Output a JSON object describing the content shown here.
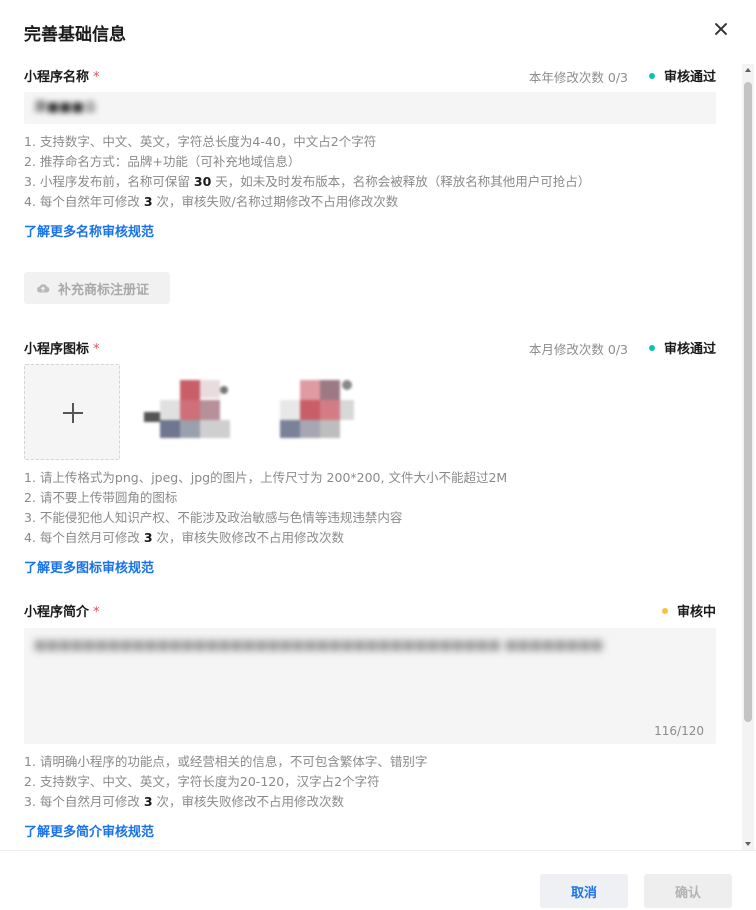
{
  "dialog": {
    "title": "完善基础信息"
  },
  "name_section": {
    "label": "小程序名称",
    "required_mark": "*",
    "quota": "本年修改次数 0/3",
    "status": "审核通过",
    "status_color": "#07c1c1",
    "input_value": "康■■■业",
    "hints": [
      {
        "pre": "1. 支持数字、中文、英文，字符总长度为4-40，中文占2个字符"
      },
      {
        "pre": "2. 推荐命名方式：品牌+功能（可补充地域信息）"
      },
      {
        "pre": "3. 小程序发布前，名称可保留 ",
        "bold": "30",
        "post": " 天，如未及时发布版本，名称会被释放（释放名称其他用户可抢占）"
      },
      {
        "pre": "4. 每个自然年可修改 ",
        "bold": "3",
        "post": " 次，审核失败/名称过期修改不占用修改次数"
      }
    ],
    "link": "了解更多名称审核规范",
    "trademark_button": "补充商标注册证",
    "trademark_icon": "cloud-upload-icon"
  },
  "icon_section": {
    "label": "小程序图标",
    "required_mark": "*",
    "quota": "本月修改次数 0/3",
    "status": "审核通过",
    "status_color": "#07c1c1",
    "upload_icon": "plus-icon",
    "hints": [
      {
        "pre": "1. 请上传格式为png、jpeg、jpg的图片，上传尺寸为 200*200, 文件大小不能超过2M"
      },
      {
        "pre": "2. 请不要上传带圆角的图标"
      },
      {
        "pre": "3. 不能侵犯他人知识产权、不能涉及政治敏感与色情等违规违禁内容"
      },
      {
        "pre": "4. 每个自然月可修改 ",
        "bold": "3",
        "post": " 次，审核失败修改不占用修改次数"
      }
    ],
    "link": "了解更多图标审核规范"
  },
  "intro_section": {
    "label": "小程序简介",
    "required_mark": "*",
    "status": "审核中",
    "status_color": "#f5c242",
    "textarea_text": "■■■■■■■■■■■■■■■■■■■■■■■■■■■■■■■■■■■■■■ ■■■■■■■■",
    "counter": "116/120",
    "hints": [
      {
        "pre": "1. 请明确小程序的功能点，或经营相关的信息，不可包含繁体字、错别字"
      },
      {
        "pre": "2. 支持数字、中文、英文，字符长度为20-120，汉字占2个字符"
      },
      {
        "pre": "3. 每个自然月可修改 ",
        "bold": "3",
        "post": " 次，审核失败修改不占用修改次数"
      }
    ],
    "link": "了解更多简介审核规范"
  },
  "footer": {
    "cancel": "取消",
    "confirm": "确认"
  }
}
